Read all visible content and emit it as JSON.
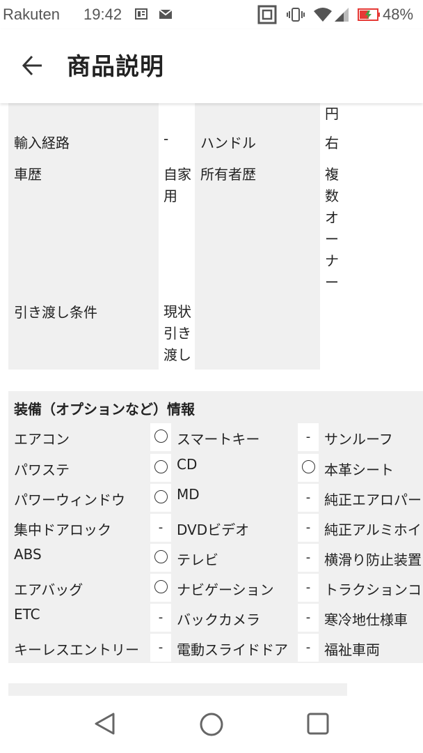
{
  "status_bar": {
    "carrier": "Rakuten",
    "time": "19:42",
    "battery": "48%",
    "icons": [
      "news-icon",
      "mail-icon",
      "nfc-icon",
      "vibrate-icon",
      "wifi-icon",
      "signal-icon",
      "battery-charging-icon"
    ],
    "battery_color": "#e53935",
    "battery_bolt_color": "#43a047"
  },
  "app_bar": {
    "title": "商品説明",
    "back_icon": "arrow-left-icon"
  },
  "spec_table": {
    "rows": [
      {
        "label": "",
        "value": "",
        "label2": "",
        "value2": "円"
      },
      {
        "label": "輸入経路",
        "value": "-",
        "label2": "ハンドル",
        "value2": "右"
      },
      {
        "label": "車歴",
        "value": "自家\n用",
        "label2": "所有者歴",
        "value2": "複\n数\nオ\nー\nナ\nー"
      },
      {
        "label": "引き渡し条件",
        "value": "現状\n引き\n渡し",
        "label2": "",
        "value2": ""
      }
    ]
  },
  "equipment": {
    "title": "装備（オプションなど）情報",
    "rows": [
      [
        {
          "label": "エアコン",
          "value": "○"
        },
        {
          "label": "スマートキー",
          "value": "-"
        },
        {
          "label": "サンルーフ",
          "value": ""
        }
      ],
      [
        {
          "label": "パワステ",
          "value": "○"
        },
        {
          "label": "CD",
          "value": "○"
        },
        {
          "label": "本革シート",
          "value": ""
        }
      ],
      [
        {
          "label": "パワーウィンドウ",
          "value": "○"
        },
        {
          "label": "MD",
          "value": "-"
        },
        {
          "label": "純正エアロパー",
          "value": ""
        }
      ],
      [
        {
          "label": "集中ドアロック",
          "value": "-"
        },
        {
          "label": "DVDビデオ",
          "value": "-"
        },
        {
          "label": "純正アルミホイ",
          "value": ""
        }
      ],
      [
        {
          "label": "ABS",
          "value": "○"
        },
        {
          "label": "テレビ",
          "value": "-"
        },
        {
          "label": "横滑り防止装置",
          "value": ""
        }
      ],
      [
        {
          "label": "エアバッグ",
          "value": "○"
        },
        {
          "label": "ナビゲーション",
          "value": "-"
        },
        {
          "label": "トラクションコ",
          "value": ""
        }
      ],
      [
        {
          "label": "ETC",
          "value": "-"
        },
        {
          "label": "バックカメラ",
          "value": "-"
        },
        {
          "label": "寒冷地仕様車",
          "value": ""
        }
      ],
      [
        {
          "label": "キーレスエントリー",
          "value": "-"
        },
        {
          "label": "電動スライドドア",
          "value": "-"
        },
        {
          "label": "福祉車両",
          "value": ""
        }
      ]
    ]
  },
  "nav_bar": {
    "icons": [
      "back-triangle-icon",
      "home-circle-icon",
      "recents-square-icon"
    ]
  }
}
